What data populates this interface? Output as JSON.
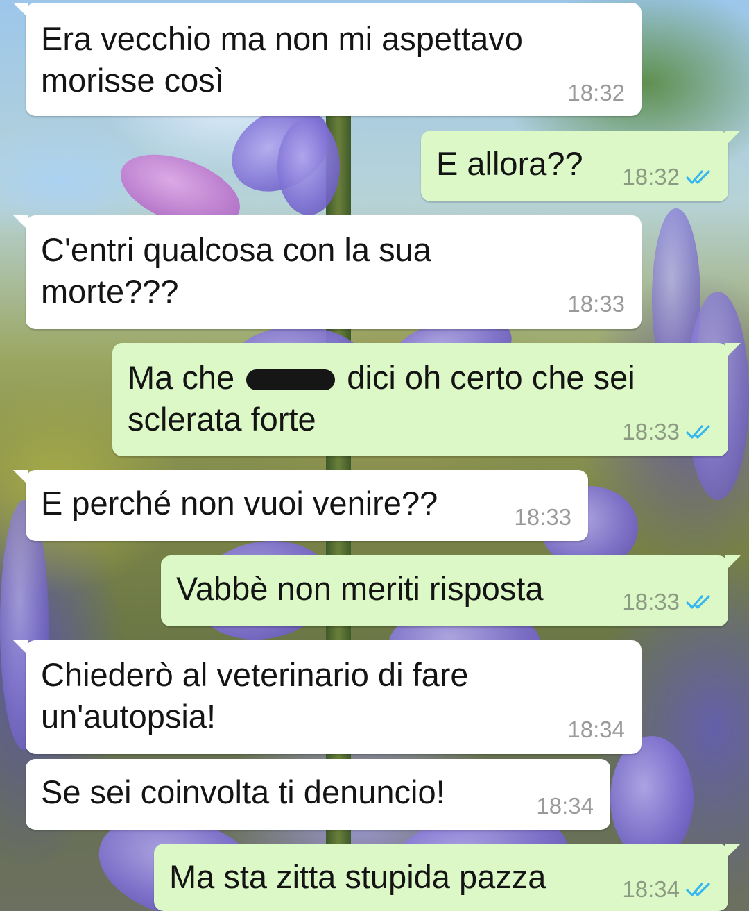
{
  "chat": {
    "colors": {
      "incoming_bubble": "#ffffff",
      "outgoing_bubble": "#dcf8c6",
      "read_ticks": "#34b7f1"
    },
    "messages": [
      {
        "direction": "incoming",
        "line1": "Era vecchio ma non mi aspettavo",
        "line2": "morisse così",
        "time": "18:32"
      },
      {
        "direction": "outgoing",
        "line1": "E allora??",
        "time": "18:32",
        "status": "read"
      },
      {
        "direction": "incoming",
        "line1": "C'entri qualcosa con la sua",
        "line2": "morte???",
        "time": "18:33"
      },
      {
        "direction": "outgoing",
        "line1_part1": "Ma che",
        "line1_part2": "dici oh certo che sei",
        "line2": "sclerata forte",
        "time": "18:33",
        "status": "read",
        "redaction": "censored-word"
      },
      {
        "direction": "incoming",
        "line1": "E perché non vuoi venire??",
        "time": "18:33"
      },
      {
        "direction": "outgoing",
        "line1": "Vabbè non meriti risposta",
        "time": "18:33",
        "status": "read"
      },
      {
        "direction": "incoming",
        "line1": "Chiederò al veterinario di fare",
        "line2": "un'autopsia!",
        "time": "18:34"
      },
      {
        "direction": "incoming",
        "line1": "Se sei coinvolta ti denuncio!",
        "time": "18:34"
      },
      {
        "direction": "outgoing",
        "line1": "Ma sta zitta stupida pazza",
        "time": "18:34",
        "status": "read"
      }
    ],
    "icons": {
      "read_receipt": "double-check-icon",
      "redaction": "censor-blot"
    }
  }
}
